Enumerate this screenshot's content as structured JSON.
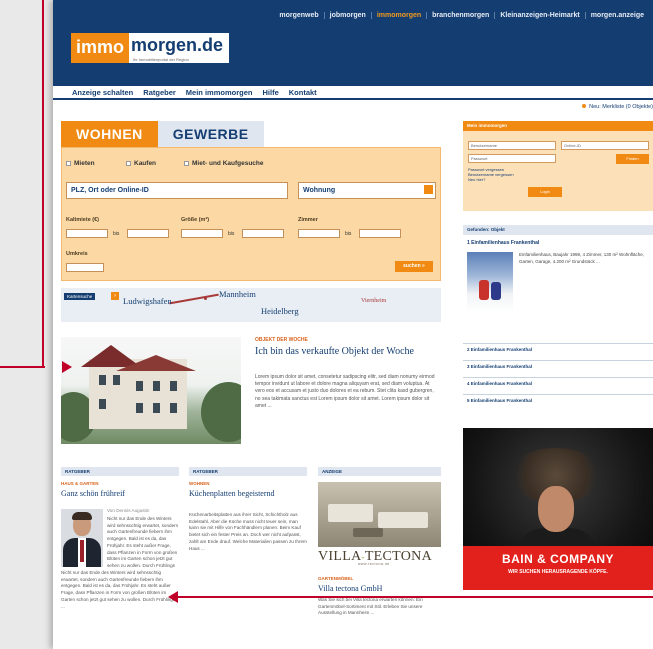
{
  "topnav": {
    "links": [
      "morgenweb",
      "jobmorgen",
      "immomorgen",
      "branchenmorgen",
      "Kleinanzeigen-Heimarkt",
      "morgen.anzeige"
    ],
    "active_index": 2
  },
  "logo": {
    "part1": "immo",
    "part2": "morgen.de",
    "tagline": "Ihr Immobilienportal der Region"
  },
  "mainnav": [
    "Anzeige schalten",
    "Ratgeber",
    "Mein immomorgen",
    "Hilfe",
    "Kontakt"
  ],
  "rightlink": "Neu: Merkliste (0 Objekte)",
  "tabs": {
    "wohnen": "WOHNEN",
    "gewerbe": "GEWERBE"
  },
  "search": {
    "checks": [
      "Mieten",
      "Kaufen",
      "Miet- und Kaufgesuche"
    ],
    "location": "PLZ, Ort oder Online-ID",
    "type": "Wohnung",
    "labels": {
      "price": "Kaltmiete (€)",
      "area": "Größe (m²)",
      "rooms": "Zimmer",
      "radius": "Umkreis"
    },
    "bis": "bis",
    "submit": "suchen »"
  },
  "map": {
    "badge": "Kartensuche",
    "cities": [
      "Ludwigshafen",
      "Mannheim",
      "Heidelberg",
      "Viernheim"
    ]
  },
  "featured": {
    "kicker": "OBJEKT DER WOCHE",
    "title": "Ich bin das verkaufte Objekt der Woche",
    "text": "Lorem ipsum dolor sit amet, consetetur sadipscing elitr, sed diam nonumy eirmod tempor invidunt ut labore et dolore magna aliquyam erat, sed diam voluptua. At vero eos et accusam et justo duo dolores et ea rebum. Stet clita kasd gubergren, no sea takimata sanctus est Lorem ipsum dolor sit amet. Lorem ipsum dolor sit amet ..."
  },
  "columns": [
    {
      "header": "RATGEBER",
      "kicker": "HAUS & GARTEN",
      "title": "Ganz schön frühreif",
      "byline": "Von Dennis Augustin",
      "text": "Nicht nur das Ende des Winters wird sehnsüchtig erwartet, sondern auch Gartenfreunde fiebern ihm entgegen. Bald ist es da, das Frühjahr. Es steht außer Frage, dass Pflanzen in Form von großen Blüten im Garten schon jetzt gut sehen zu wollen. Durch Frühlings ..."
    },
    {
      "header": "RATGEBER",
      "kicker": "WOHNEN",
      "title": "Küchenplatten begeisternd",
      "text": "Küchenarbeitsplatten aus ihrer Sicht, Schichtholz aus Edelstahl. Aber die Küche muss nicht teuer sein, man kann sie mit Hilfe von Fachhändlern planen. Beim Kauf bietet sich ein fester Preis an. Doch wer nicht aufpasst, zahlt am Ende drauf. Welche Materialien passen zu Ihrem Haus ..."
    },
    {
      "header": "ANZEIGE",
      "kicker": "GARTENMÖBEL",
      "title": "Villa tectona GmbH",
      "brand": {
        "name1": "VILLA",
        "joint": "-",
        "name2": "TECTONA",
        "sub": "www.tectona.de"
      },
      "text": "Was Sie sich bei Villa tectona erwarten können: Ein Gartenmöbel-Sortiment mit Stil. Erleben Sie unsere Ausstellung in Mannheim ..."
    }
  ],
  "login": {
    "title": "Mein immomorgen",
    "user": "Benutzername",
    "id": "Online-ID",
    "pw": "Passwort",
    "go": "Finden",
    "links": [
      "Passwort vergessen",
      "Benutzername vergessen",
      "Neu hier?"
    ],
    "submit": "Login"
  },
  "objects": {
    "title": "Gefunden: Objekt",
    "first": "1 Einfamilienhaus Frankenthal",
    "first_desc": "Einfamilienhaus, Baujahr 1998, 4 Zimmer, 130 m² Wohnfläche, Garten, Garage, 4.200 m² Grundstück ...",
    "list": [
      "2 Einfamilienhaus Frankenthal",
      "3 Einfamilienhaus Frankenthal",
      "4 Einfamilienhaus Frankenthal",
      "5 Einfamilienhaus Frankenthal"
    ]
  },
  "ad": {
    "brand": "BAIN & COMPANY",
    "tagline": "WIR SUCHEN HERAUSRAGENDE KÖPFE."
  },
  "colors": {
    "navy": "#143e72",
    "orange": "#f08a12",
    "arrow": "#c1002a",
    "ad_red": "#e2211c"
  }
}
